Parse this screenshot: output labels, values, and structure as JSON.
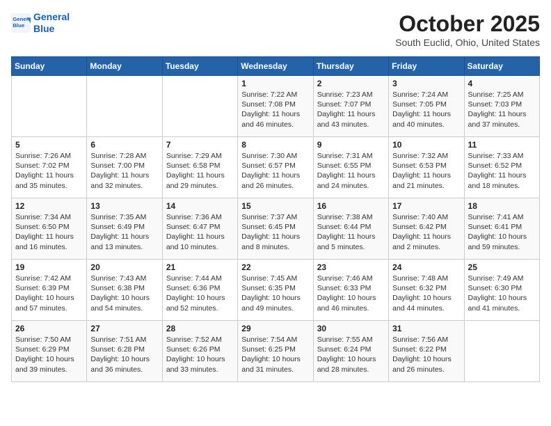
{
  "header": {
    "logo_line1": "General",
    "logo_line2": "Blue",
    "title": "October 2025",
    "subtitle": "South Euclid, Ohio, United States"
  },
  "weekdays": [
    "Sunday",
    "Monday",
    "Tuesday",
    "Wednesday",
    "Thursday",
    "Friday",
    "Saturday"
  ],
  "weeks": [
    [
      {
        "day": "",
        "info": ""
      },
      {
        "day": "",
        "info": ""
      },
      {
        "day": "",
        "info": ""
      },
      {
        "day": "1",
        "info": "Sunrise: 7:22 AM\nSunset: 7:08 PM\nDaylight: 11 hours\nand 46 minutes."
      },
      {
        "day": "2",
        "info": "Sunrise: 7:23 AM\nSunset: 7:07 PM\nDaylight: 11 hours\nand 43 minutes."
      },
      {
        "day": "3",
        "info": "Sunrise: 7:24 AM\nSunset: 7:05 PM\nDaylight: 11 hours\nand 40 minutes."
      },
      {
        "day": "4",
        "info": "Sunrise: 7:25 AM\nSunset: 7:03 PM\nDaylight: 11 hours\nand 37 minutes."
      }
    ],
    [
      {
        "day": "5",
        "info": "Sunrise: 7:26 AM\nSunset: 7:02 PM\nDaylight: 11 hours\nand 35 minutes."
      },
      {
        "day": "6",
        "info": "Sunrise: 7:28 AM\nSunset: 7:00 PM\nDaylight: 11 hours\nand 32 minutes."
      },
      {
        "day": "7",
        "info": "Sunrise: 7:29 AM\nSunset: 6:58 PM\nDaylight: 11 hours\nand 29 minutes."
      },
      {
        "day": "8",
        "info": "Sunrise: 7:30 AM\nSunset: 6:57 PM\nDaylight: 11 hours\nand 26 minutes."
      },
      {
        "day": "9",
        "info": "Sunrise: 7:31 AM\nSunset: 6:55 PM\nDaylight: 11 hours\nand 24 minutes."
      },
      {
        "day": "10",
        "info": "Sunrise: 7:32 AM\nSunset: 6:53 PM\nDaylight: 11 hours\nand 21 minutes."
      },
      {
        "day": "11",
        "info": "Sunrise: 7:33 AM\nSunset: 6:52 PM\nDaylight: 11 hours\nand 18 minutes."
      }
    ],
    [
      {
        "day": "12",
        "info": "Sunrise: 7:34 AM\nSunset: 6:50 PM\nDaylight: 11 hours\nand 16 minutes."
      },
      {
        "day": "13",
        "info": "Sunrise: 7:35 AM\nSunset: 6:49 PM\nDaylight: 11 hours\nand 13 minutes."
      },
      {
        "day": "14",
        "info": "Sunrise: 7:36 AM\nSunset: 6:47 PM\nDaylight: 11 hours\nand 10 minutes."
      },
      {
        "day": "15",
        "info": "Sunrise: 7:37 AM\nSunset: 6:45 PM\nDaylight: 11 hours\nand 8 minutes."
      },
      {
        "day": "16",
        "info": "Sunrise: 7:38 AM\nSunset: 6:44 PM\nDaylight: 11 hours\nand 5 minutes."
      },
      {
        "day": "17",
        "info": "Sunrise: 7:40 AM\nSunset: 6:42 PM\nDaylight: 11 hours\nand 2 minutes."
      },
      {
        "day": "18",
        "info": "Sunrise: 7:41 AM\nSunset: 6:41 PM\nDaylight: 10 hours\nand 59 minutes."
      }
    ],
    [
      {
        "day": "19",
        "info": "Sunrise: 7:42 AM\nSunset: 6:39 PM\nDaylight: 10 hours\nand 57 minutes."
      },
      {
        "day": "20",
        "info": "Sunrise: 7:43 AM\nSunset: 6:38 PM\nDaylight: 10 hours\nand 54 minutes."
      },
      {
        "day": "21",
        "info": "Sunrise: 7:44 AM\nSunset: 6:36 PM\nDaylight: 10 hours\nand 52 minutes."
      },
      {
        "day": "22",
        "info": "Sunrise: 7:45 AM\nSunset: 6:35 PM\nDaylight: 10 hours\nand 49 minutes."
      },
      {
        "day": "23",
        "info": "Sunrise: 7:46 AM\nSunset: 6:33 PM\nDaylight: 10 hours\nand 46 minutes."
      },
      {
        "day": "24",
        "info": "Sunrise: 7:48 AM\nSunset: 6:32 PM\nDaylight: 10 hours\nand 44 minutes."
      },
      {
        "day": "25",
        "info": "Sunrise: 7:49 AM\nSunset: 6:30 PM\nDaylight: 10 hours\nand 41 minutes."
      }
    ],
    [
      {
        "day": "26",
        "info": "Sunrise: 7:50 AM\nSunset: 6:29 PM\nDaylight: 10 hours\nand 39 minutes."
      },
      {
        "day": "27",
        "info": "Sunrise: 7:51 AM\nSunset: 6:28 PM\nDaylight: 10 hours\nand 36 minutes."
      },
      {
        "day": "28",
        "info": "Sunrise: 7:52 AM\nSunset: 6:26 PM\nDaylight: 10 hours\nand 33 minutes."
      },
      {
        "day": "29",
        "info": "Sunrise: 7:54 AM\nSunset: 6:25 PM\nDaylight: 10 hours\nand 31 minutes."
      },
      {
        "day": "30",
        "info": "Sunrise: 7:55 AM\nSunset: 6:24 PM\nDaylight: 10 hours\nand 28 minutes."
      },
      {
        "day": "31",
        "info": "Sunrise: 7:56 AM\nSunset: 6:22 PM\nDaylight: 10 hours\nand 26 minutes."
      },
      {
        "day": "",
        "info": ""
      }
    ]
  ]
}
